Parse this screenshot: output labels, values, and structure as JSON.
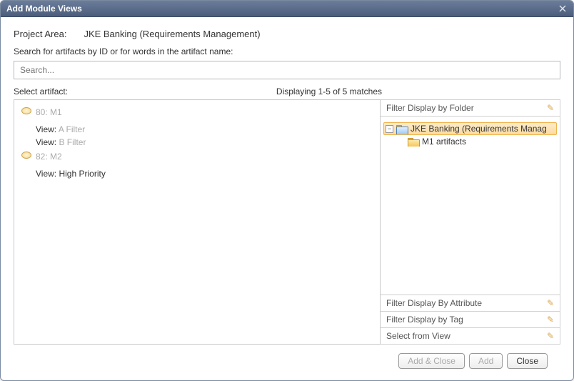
{
  "dialog": {
    "title": "Add Module Views"
  },
  "project": {
    "label": "Project Area:",
    "value": "JKE Banking (Requirements Management)"
  },
  "search": {
    "label": "Search for artifacts by ID or for words in the artifact name:",
    "placeholder": "Search..."
  },
  "listheader": {
    "select_label": "Select artifact:",
    "displaying": "Displaying 1-5 of 5 matches"
  },
  "artifacts": [
    {
      "id": "80: M1",
      "views": [
        {
          "label": "View: ",
          "name": "A Filter",
          "muted": true
        },
        {
          "label": "View: ",
          "name": "B Filter",
          "muted": true
        }
      ]
    },
    {
      "id": "82: M2",
      "views": [
        {
          "label": "View: ",
          "name": "High Priority",
          "muted": false
        }
      ]
    }
  ],
  "filters": {
    "by_folder_label": "Filter Display by Folder",
    "tree": {
      "root": {
        "label": "JKE Banking (Requirements Manag"
      },
      "child": {
        "label": "M1 artifacts"
      }
    },
    "by_attribute_label": "Filter Display By Attribute",
    "by_tag_label": "Filter Display by Tag",
    "select_from_view_label": "Select from View"
  },
  "buttons": {
    "add_close": "Add & Close",
    "add": "Add",
    "close": "Close"
  }
}
